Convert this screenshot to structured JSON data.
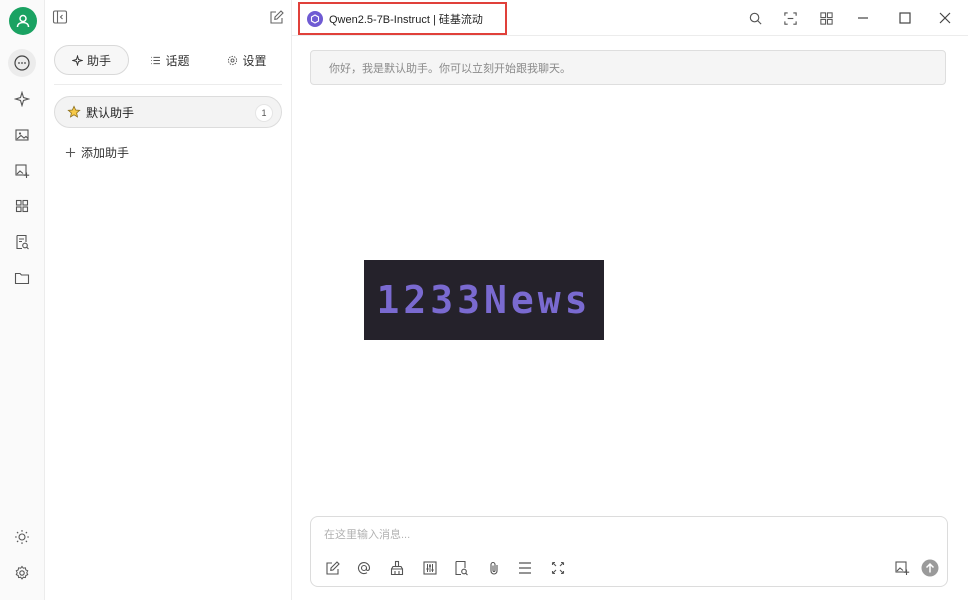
{
  "sidebar_tabs": {
    "assistants": "助手",
    "topics": "话题",
    "settings": "设置"
  },
  "assistants": [
    {
      "name": "默认助手",
      "count": "1"
    }
  ],
  "add_assistant_label": "添加助手",
  "model_selector": {
    "model": "Qwen2.5-7B-Instruct",
    "provider": "硅基流动"
  },
  "chat": {
    "welcome": "你好，我是默认助手。你可以立刻开始跟我聊天。"
  },
  "input": {
    "placeholder": "在这里输入消息..."
  },
  "watermark": {
    "text": "1233News"
  },
  "colors": {
    "accent": "#1aa262",
    "highlight_border": "#e0403a",
    "model_logo": "#6f5bd3"
  },
  "icons": [
    "user-avatar-icon",
    "chat-icon",
    "sparkle-icon",
    "image-icon",
    "image-add-icon",
    "grid-icon",
    "file-search-icon",
    "folder-icon",
    "sun-icon",
    "gear-icon",
    "collapse-sidebar-icon",
    "edit-icon",
    "search-icon",
    "expand-icon",
    "apps-icon",
    "minimize-icon",
    "maximize-icon",
    "close-icon",
    "new-topic-icon",
    "mention-icon",
    "clear-icon",
    "adjust-icon",
    "file-search-icon",
    "attachment-icon",
    "divider-icon",
    "fullscreen-icon",
    "image-add-icon",
    "send-icon"
  ]
}
